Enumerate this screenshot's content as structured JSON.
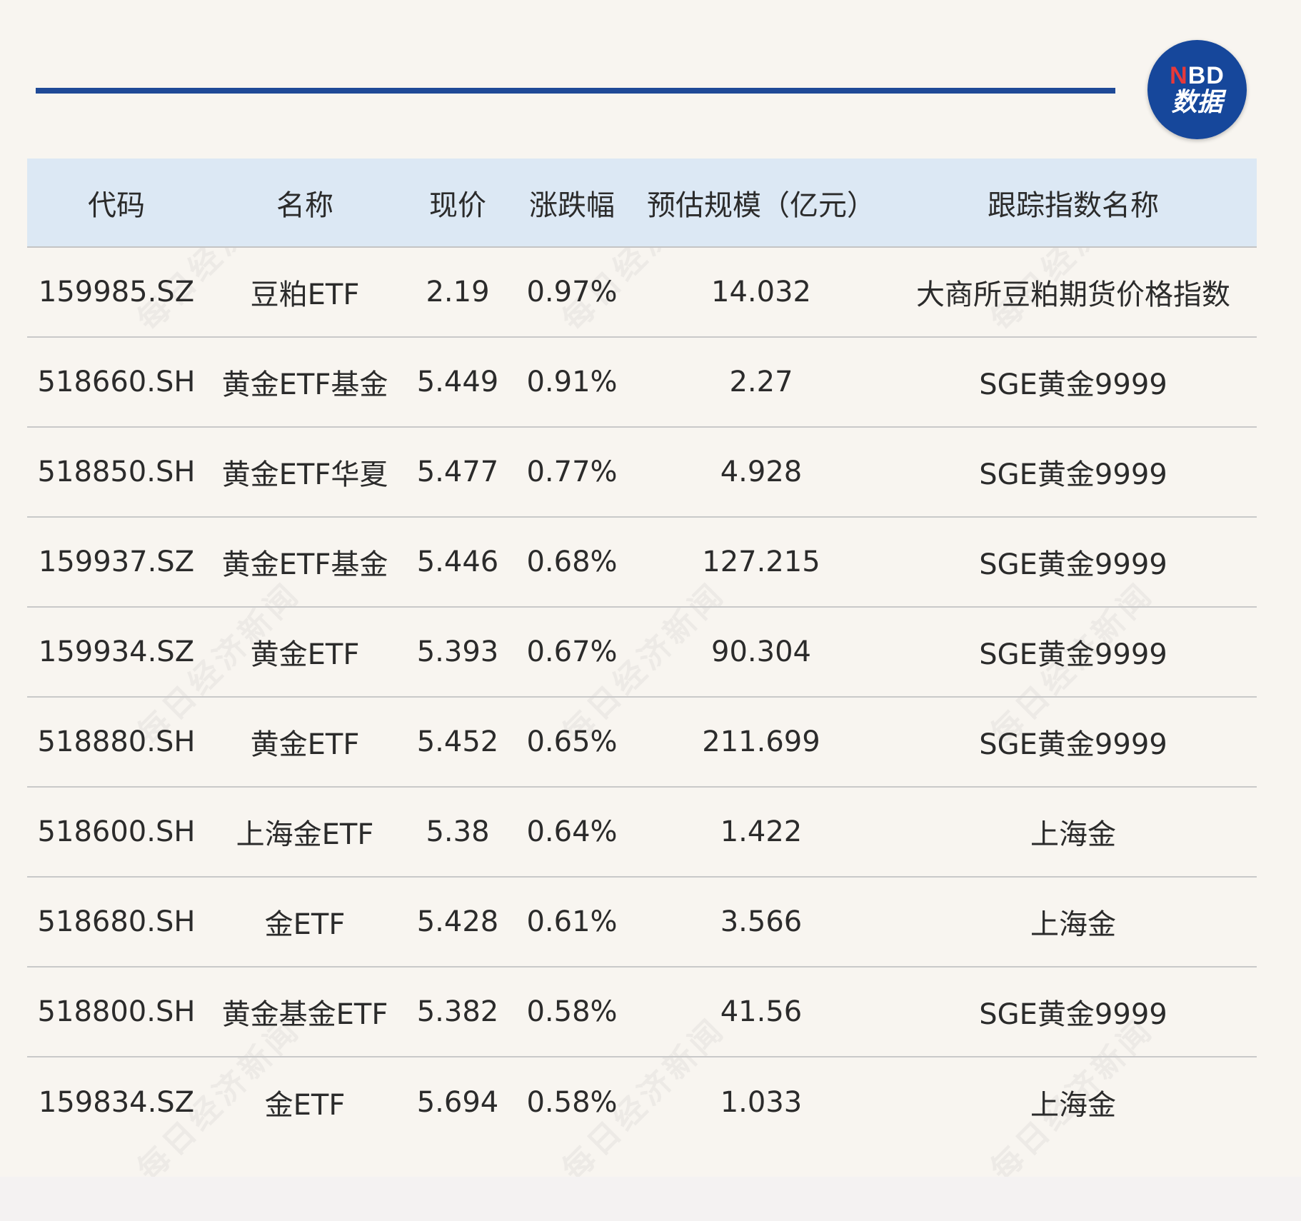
{
  "logo": {
    "n": "N",
    "bd": "BD",
    "bottom": "数据"
  },
  "watermark_text": "每日经济新闻",
  "table": {
    "headers": [
      "代码",
      "名称",
      "现价",
      "涨跌幅",
      "预估规模（亿元）",
      "跟踪指数名称"
    ],
    "rows": [
      [
        "159985.SZ",
        "豆粕ETF",
        "2.19",
        "0.97%",
        "14.032",
        "大商所豆粕期货价格指数"
      ],
      [
        "518660.SH",
        "黄金ETF基金",
        "5.449",
        "0.91%",
        "2.27",
        "SGE黄金9999"
      ],
      [
        "518850.SH",
        "黄金ETF华夏",
        "5.477",
        "0.77%",
        "4.928",
        "SGE黄金9999"
      ],
      [
        "159937.SZ",
        "黄金ETF基金",
        "5.446",
        "0.68%",
        "127.215",
        "SGE黄金9999"
      ],
      [
        "159934.SZ",
        "黄金ETF",
        "5.393",
        "0.67%",
        "90.304",
        "SGE黄金9999"
      ],
      [
        "518880.SH",
        "黄金ETF",
        "5.452",
        "0.65%",
        "211.699",
        "SGE黄金9999"
      ],
      [
        "518600.SH",
        "上海金ETF",
        "5.38",
        "0.64%",
        "1.422",
        "上海金"
      ],
      [
        "518680.SH",
        "金ETF",
        "5.428",
        "0.61%",
        "3.566",
        "上海金"
      ],
      [
        "518800.SH",
        "黄金基金ETF",
        "5.382",
        "0.58%",
        "41.56",
        "SGE黄金9999"
      ],
      [
        "159834.SZ",
        "金ETF",
        "5.694",
        "0.58%",
        "1.033",
        "上海金"
      ]
    ]
  },
  "colors": {
    "accent_line": "#1f4a97",
    "logo_bg": "#16479b",
    "logo_n": "#e8393a",
    "header_bg": "#dce8f4",
    "page_bg": "#f8f5f0"
  }
}
